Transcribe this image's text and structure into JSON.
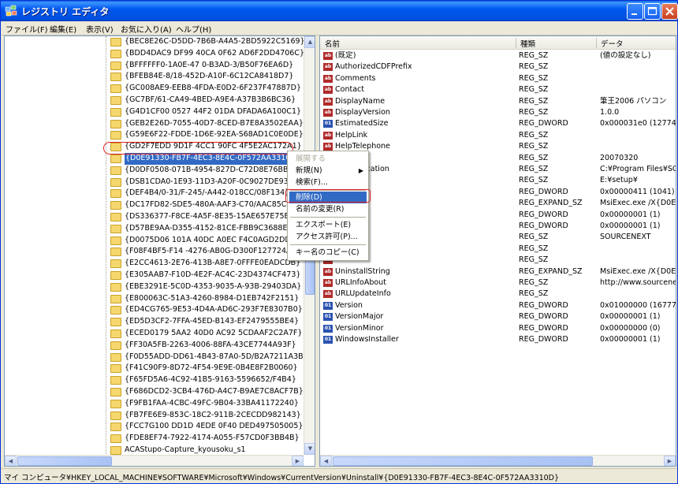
{
  "window": {
    "title": "レジストリ エディタ"
  },
  "menu": [
    "ファイル(F)",
    "編集(E)",
    "表示(V)",
    "お気に入り(A)",
    "ヘルプ(H)"
  ],
  "tree": {
    "items": [
      "{BEC8E26C-D5DD-7B6B-A4A5-2BD5922C5169}",
      "{BDD4DAC9 DF99 40CA 0F62 AD6F2DD4706C}",
      "{BFFFFFF0-1A0E-47 0-B3AD-3/B50F76EA6D}",
      "{BFEB84E-8/18-452D-A10F-6C12CA8418D7}",
      "{GC008AE9-EEB8-4FDA-E0D2-6F237F47887D}",
      "{GC7BF/61-CA49-4BED-A9E4-A37B3B6BC36}",
      "{G4D1CF00 0527 44F2 01DA DFADA6A100C1}",
      "{GEB2E26D-7055-40D7-8CED-B7E8A3502EAA}",
      "{G59E6F22-FDDE-1D6E-92EA-S68AD1C0E0DE}",
      "{GD2F7EDD 9D1F 4CC1 90FC 4F5E2AC172A1}",
      "{D0E91330-FB7F-4EC3-8E4C-0F572AA3310D}",
      "{D0DF0508-071B-4954-827D-C72D8E76BB06}",
      "{DSB1CDA0-1E93-11D3-A20F-0C9027DE933C}",
      "{DEF4B4/0-31/F-245/-A442-018CC/08F134}",
      "{DC17FD82-SDE5-480A-AAF3-C70/AAC85C47}",
      "{DS336377-F8CE-4A5F-8E35-15AE657E75E3}",
      "{D57BE9AA-D355-4152-81CE-FBB9C3688E69}",
      "{D0075D06 101A 40DC A0EC F4C0AGD2DD54}",
      "{F08F4BF5-F14 -4276-AB0G-D300F127724A}",
      "{E2CC4613-2E76-413B-A8E7-0FFFE0EADCDB}",
      "{E305AAB7-F10D-4E2F-AC4C-23D4374CF473}",
      "{EBE3291E-5C0D-4353-9035-A-93B-29403DA}",
      "{E800063C-51A3-4260-8984-D1EB742F2151}",
      "{ED4CG765-9E53-4D4A-AD6C-293F7E8307B0}",
      "{ED5D3CF2-7FFA-45ED-B143-EF2479555BE4}",
      "{ECED0179 5AA2 40D0 AC92 5CDAAF2C2A7F}",
      "{FF30A5FB-2263-4006-88FA-43CE7744A93F}",
      "{F0D55ADD-DD61-4B43-87A0-5D/B2A7211A3B}",
      "{F41C90F9-8D72-4F54-9E9E-0B4E8F2B0060}",
      "{F65FD5A6-4C92-41B5-9163-5596652/F4B4}",
      "{F686DCD2-3CB4-476D-A4C7-B9AE7C8ACF7B}",
      "{F9FB1FAA-4CBC-49FC-9B04-33BA41172240}",
      "{FB7FE6E9-853C-18C2-911B-2CECDD982143}",
      "{FCC7G100 DD1D 4EDE 0F40 DED497505005}",
      "{FDE8EF74-7922-4174-A055-F57CD0F3BB4B}",
      "ACAStupo-Capture_kyousoku_s1",
      "AddressBook",
      "AudioPluginU1",
      "CNXT_MODEM_HDAUDIO_VEN_14F18DEV_2EFA&SU"
    ]
  },
  "list": {
    "headers": [
      "名前",
      "種類",
      "データ"
    ],
    "rows": [
      {
        "icon": "ab",
        "name": "(既定)",
        "type": "REG_SZ",
        "data": "(値の設定なし)"
      },
      {
        "icon": "ab",
        "name": "AuthorizedCDFPrefix",
        "type": "REG_SZ",
        "data": ""
      },
      {
        "icon": "ab",
        "name": "Comments",
        "type": "REG_SZ",
        "data": ""
      },
      {
        "icon": "ab",
        "name": "Contact",
        "type": "REG_SZ",
        "data": ""
      },
      {
        "icon": "ab",
        "name": "DisplayName",
        "type": "REG_SZ",
        "data": "筆王2006 パソコン"
      },
      {
        "icon": "ab",
        "name": "DisplayVersion",
        "type": "REG_SZ",
        "data": "1.0.0"
      },
      {
        "icon": "bin",
        "name": "EstimatedSize",
        "type": "REG_DWORD",
        "data": "0x000031e0 (12774)"
      },
      {
        "icon": "ab",
        "name": "HelpLink",
        "type": "REG_SZ",
        "data": ""
      },
      {
        "icon": "ab",
        "name": "HelpTelephone",
        "type": "REG_SZ",
        "data": ""
      },
      {
        "icon": "ab",
        "name": "",
        "type": "REG_SZ",
        "data": "20070320"
      },
      {
        "icon": "ab",
        "name": "InstallLocation",
        "type": "REG_SZ",
        "data": "C:¥Program Files¥SOU"
      },
      {
        "icon": "ab",
        "name": "",
        "type": "REG_SZ",
        "data": "E:¥setup¥"
      },
      {
        "icon": "bin",
        "name": "",
        "type": "REG_DWORD",
        "data": "0x00000411 (1041)"
      },
      {
        "icon": "ab",
        "name": "",
        "type": "REG_EXPAND_SZ",
        "data": "MsiExec.exe /X{D0E91"
      },
      {
        "icon": "bin",
        "name": "",
        "type": "REG_DWORD",
        "data": "0x00000001 (1)"
      },
      {
        "icon": "bin",
        "name": "",
        "type": "REG_DWORD",
        "data": "0x00000001 (1)"
      },
      {
        "icon": "ab",
        "name": "",
        "type": "REG_SZ",
        "data": "SOURCENEXT"
      },
      {
        "icon": "ab",
        "name": "",
        "type": "REG_SZ",
        "data": ""
      },
      {
        "icon": "ab",
        "name": "",
        "type": "REG_SZ",
        "data": ""
      },
      {
        "icon": "ab",
        "name": "UninstallString",
        "type": "REG_EXPAND_SZ",
        "data": "MsiExec.exe /X{D0E91"
      },
      {
        "icon": "ab",
        "name": "URLInfoAbout",
        "type": "REG_SZ",
        "data": "http://www.sourcenext"
      },
      {
        "icon": "ab",
        "name": "URLUpdateInfo",
        "type": "REG_SZ",
        "data": ""
      },
      {
        "icon": "bin",
        "name": "Version",
        "type": "REG_DWORD",
        "data": "0x01000000 (16777216)"
      },
      {
        "icon": "bin",
        "name": "VersionMajor",
        "type": "REG_DWORD",
        "data": "0x00000001 (1)"
      },
      {
        "icon": "bin",
        "name": "VersionMinor",
        "type": "REG_DWORD",
        "data": "0x00000000 (0)"
      },
      {
        "icon": "bin",
        "name": "WindowsInstaller",
        "type": "REG_DWORD",
        "data": "0x00000001 (1)"
      }
    ]
  },
  "context_menu": {
    "expand": "展開する",
    "new": "新規(N)",
    "find": "検索(F)...",
    "delete": "削除(D)",
    "rename": "名前の変更(R)",
    "export": "エクスポート(E)",
    "permissions": "アクセス許可(P)...",
    "copy_key": "キー名のコピー(C)"
  },
  "status_bar": "マイ コンピュータ¥HKEY_LOCAL_MACHINE¥SOFTWARE¥Microsoft¥Windows¥CurrentVersion¥Uninstall¥{D0E91330-FB7F-4EC3-8E4C-0F572AA3310D}",
  "colors": {
    "selection": "#316ac5",
    "annotation": "#e02020",
    "titlebar": "#0058ee"
  }
}
